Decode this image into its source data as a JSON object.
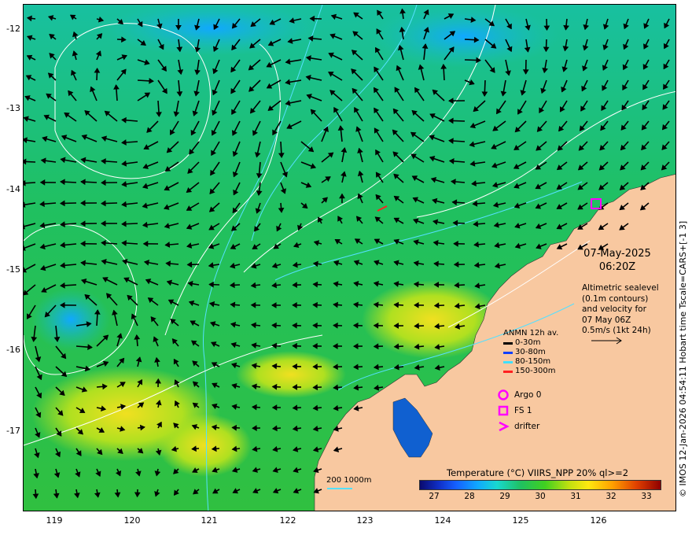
{
  "map": {
    "lat_ticks": [
      "-12",
      "-13",
      "-14",
      "-15",
      "-16",
      "-17"
    ],
    "lon_ticks": [
      "119",
      "120",
      "121",
      "122",
      "123",
      "124",
      "125",
      "126"
    ],
    "date": "07-May-2025",
    "time": "06:20Z",
    "altimetry_note": [
      "Altimetric sealevel",
      "(0.1m contours)",
      "and velocity for",
      "07 May 06Z",
      "0.5m/s (1kt 24h)"
    ],
    "colors": {
      "land": "#f8c8a0",
      "ocean_mid": "#20c060",
      "contour": "#ffffff",
      "bathy": "#55e0ff"
    }
  },
  "current_legend": {
    "title": "ANMN 12h av.",
    "items": [
      {
        "label": "0-30m",
        "color": "#000000"
      },
      {
        "label": "30-80m",
        "color": "#1040ff"
      },
      {
        "label": "80-150m",
        "color": "#40e0ff"
      },
      {
        "label": "150-300m",
        "color": "#ff2020"
      }
    ]
  },
  "platforms": [
    {
      "label": "Argo 0",
      "symbol": "circle",
      "color": "#ff00ff"
    },
    {
      "label": "FS 1",
      "symbol": "square",
      "color": "#ff00ff"
    },
    {
      "label": "drifter",
      "symbol": "chevron",
      "color": "#ff00ff"
    }
  ],
  "colorbar": {
    "title": "Temperature (°C) VIIRS_NPP 20% ql>=2",
    "ticks": [
      "27",
      "28",
      "29",
      "30",
      "31",
      "32",
      "33"
    ]
  },
  "scale": {
    "label": "200  1000m"
  },
  "credit": "© IMOS 12-Jan-2026 04:54:11 Hobart time Tscale=CARS+[-1 3]"
}
